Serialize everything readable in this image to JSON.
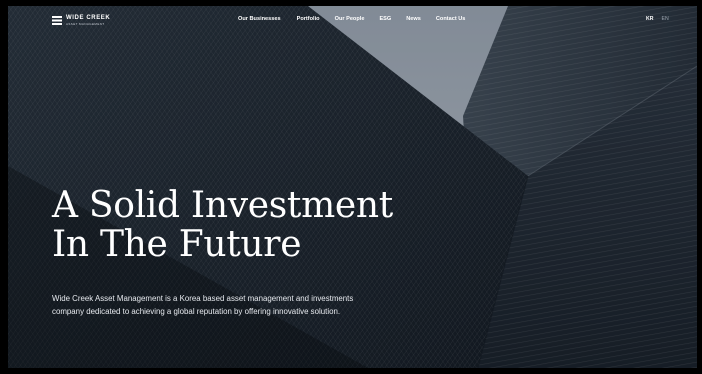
{
  "header": {
    "logo": {
      "name": "WIDE CREEK",
      "subtitle": "ASSET MANAGEMENT"
    },
    "nav": [
      {
        "label": "Our Businesses"
      },
      {
        "label": "Portfolio"
      },
      {
        "label": "Our People"
      },
      {
        "label": "ESG"
      },
      {
        "label": "News"
      },
      {
        "label": "Contact Us"
      }
    ],
    "languages": [
      {
        "label": "KR",
        "active": true
      },
      {
        "label": "EN",
        "active": false
      }
    ]
  },
  "hero": {
    "headline_line1": "A Solid Investment",
    "headline_line2": "In The Future",
    "description": "Wide Creek Asset Management is a Korea based asset management and investments company dedicated to achieving a global reputation by offering innovative solution."
  },
  "colors": {
    "sky": "#b9c4d0",
    "building_dark": "#1f2a37",
    "text": "#ffffff"
  },
  "icons": {
    "logo": "wide-creek-logo-icon"
  }
}
